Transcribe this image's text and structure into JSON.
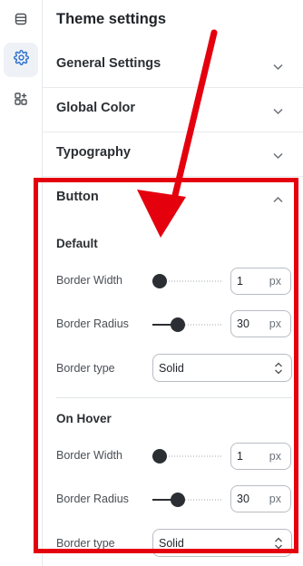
{
  "panel": {
    "title": "Theme settings",
    "sections": [
      {
        "label": "General Settings",
        "expanded": false
      },
      {
        "label": "Global Color",
        "expanded": false
      },
      {
        "label": "Typography",
        "expanded": false
      },
      {
        "label": "Button",
        "expanded": true
      }
    ]
  },
  "button_section": {
    "default": {
      "title": "Default",
      "border_width": {
        "label": "Border Width",
        "value": "1",
        "unit": "px",
        "slider_fraction": 0.0
      },
      "border_radius": {
        "label": "Border Radius",
        "value": "30",
        "unit": "px",
        "slider_fraction": 0.33
      },
      "border_type": {
        "label": "Border type",
        "value": "Solid"
      }
    },
    "hover": {
      "title": "On Hover",
      "border_width": {
        "label": "Border Width",
        "value": "1",
        "unit": "px",
        "slider_fraction": 0.0
      },
      "border_radius": {
        "label": "Border Radius",
        "value": "30",
        "unit": "px",
        "slider_fraction": 0.33
      },
      "border_type": {
        "label": "Border type",
        "value": "Solid"
      }
    }
  },
  "rail": {
    "icons": [
      "sections-icon",
      "gear-icon",
      "apps-icon"
    ],
    "active": "gear-icon"
  },
  "colors": {
    "annotation": "#e5000e",
    "active_icon": "#2c6ecb",
    "text": "#1f2328"
  }
}
